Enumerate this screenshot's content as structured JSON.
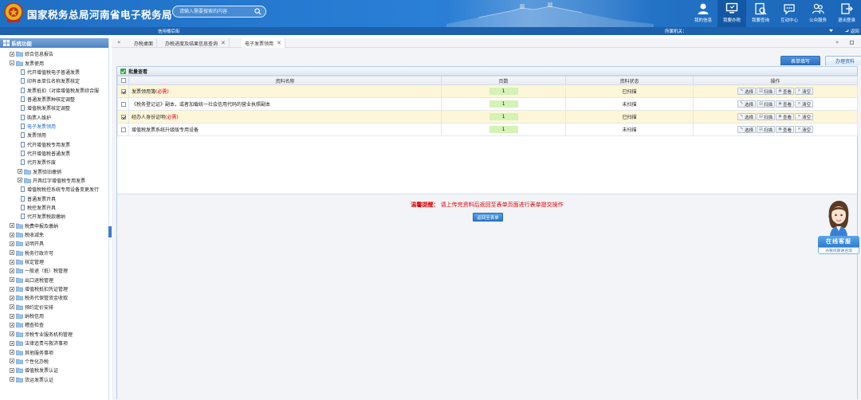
{
  "header": {
    "title": "国家税务总局河南省电子税务局",
    "search_placeholder": "请输入需要搜索的内容",
    "nav": [
      {
        "label": "我的信息",
        "icon": "user-icon"
      },
      {
        "label": "我要办税",
        "icon": "monitor-icon",
        "active": true
      },
      {
        "label": "我要查询",
        "icon": "query-icon"
      },
      {
        "label": "互动中心",
        "icon": "chat-icon"
      },
      {
        "label": "公众服务",
        "icon": "people-icon"
      },
      {
        "label": "退出登录",
        "icon": "exit-icon"
      }
    ]
  },
  "subbar": {
    "address": "信用楼后街",
    "authority": "所属机关：",
    "return_label": "返回"
  },
  "sidebar": {
    "title": "系统功能",
    "items": [
      {
        "label": "综合信息报告",
        "level": 0,
        "type": "folder",
        "expand": "plus"
      },
      {
        "label": "发票使用",
        "level": 0,
        "type": "folder",
        "expand": "minus"
      },
      {
        "label": "代开增值税电子普通发票",
        "level": 1,
        "type": "doc"
      },
      {
        "label": "印有本单位名称发票核定",
        "level": 1,
        "type": "doc"
      },
      {
        "label": "发票抵扣（对接增值税发票综合服",
        "level": 1,
        "type": "doc"
      },
      {
        "label": "普通发票票种核定调整",
        "level": 1,
        "type": "doc"
      },
      {
        "label": "增值税发票核定调整",
        "level": 1,
        "type": "doc"
      },
      {
        "label": "购票人维护",
        "level": 1,
        "type": "doc"
      },
      {
        "label": "电子发票领用",
        "level": 1,
        "type": "doc",
        "selected": true
      },
      {
        "label": "发票领用",
        "level": 1,
        "type": "doc"
      },
      {
        "label": "代开增值税专用发票",
        "level": 1,
        "type": "doc"
      },
      {
        "label": "代开增值税普通发票",
        "level": 1,
        "type": "doc"
      },
      {
        "label": "代开发票作废",
        "level": 1,
        "type": "doc"
      },
      {
        "label": "发票验旧缴销",
        "level": 1,
        "type": "folder",
        "expand": "plus"
      },
      {
        "label": "开具红字增值税专用发票",
        "level": 1,
        "type": "folder",
        "expand": "plus"
      },
      {
        "label": "增值税税控系统专用设备变更发行",
        "level": 1,
        "type": "doc"
      },
      {
        "label": "普通发票开具",
        "level": 1,
        "type": "doc"
      },
      {
        "label": "税控发票开具",
        "level": 1,
        "type": "doc"
      },
      {
        "label": "代开发票税款缴纳",
        "level": 1,
        "type": "doc"
      },
      {
        "label": "税费申报及缴纳",
        "level": 0,
        "type": "folder",
        "expand": "plus"
      },
      {
        "label": "税收减免",
        "level": 0,
        "type": "folder",
        "expand": "plus"
      },
      {
        "label": "证明开具",
        "level": 0,
        "type": "folder",
        "expand": "plus"
      },
      {
        "label": "税务行政许可",
        "level": 0,
        "type": "folder",
        "expand": "plus"
      },
      {
        "label": "核定管理",
        "level": 0,
        "type": "folder",
        "expand": "plus"
      },
      {
        "label": "一般退（抵）税管理",
        "level": 0,
        "type": "folder",
        "expand": "plus"
      },
      {
        "label": "出口退税管理",
        "level": 0,
        "type": "folder",
        "expand": "plus"
      },
      {
        "label": "增值税抵扣凭证管理",
        "level": 0,
        "type": "folder",
        "expand": "plus"
      },
      {
        "label": "税务代保管资金收取",
        "level": 0,
        "type": "folder",
        "expand": "plus"
      },
      {
        "label": "预约定价安排",
        "level": 0,
        "type": "folder",
        "expand": "plus"
      },
      {
        "label": "纳税信用",
        "level": 0,
        "type": "folder",
        "expand": "plus"
      },
      {
        "label": "稽查检查",
        "level": 0,
        "type": "folder",
        "expand": "plus"
      },
      {
        "label": "涉税专业服务机构管理",
        "level": 0,
        "type": "folder",
        "expand": "plus"
      },
      {
        "label": "法律追责与救济事项",
        "level": 0,
        "type": "folder",
        "expand": "plus"
      },
      {
        "label": "其他服务事项",
        "level": 0,
        "type": "folder",
        "expand": "plus"
      },
      {
        "label": "个性化办税",
        "level": 0,
        "type": "folder",
        "expand": "plus"
      },
      {
        "label": "增值税发票认证",
        "level": 0,
        "type": "folder",
        "expand": "plus"
      },
      {
        "label": "货运发票认证",
        "level": 0,
        "type": "folder",
        "expand": "plus"
      }
    ]
  },
  "tabs": {
    "items": [
      {
        "label": "办税桌面",
        "closable": false
      },
      {
        "label": "办税进度及结果信息查询",
        "closable": true
      },
      {
        "label": "电子发票领用",
        "closable": true,
        "active": true
      }
    ]
  },
  "subtabs": {
    "form_fill": "表单填写",
    "upload": "办理资料"
  },
  "panel": {
    "title": "批量查看",
    "columns": [
      "资料名称",
      "页数",
      "资料状态",
      "操作"
    ],
    "rows": [
      {
        "name": "发票领用簿",
        "required": "(必需)",
        "pages": "1",
        "status": "已扫描",
        "status_type": "ok",
        "checked": true,
        "highlight": true
      },
      {
        "name": "《税务登记证》副本，或者加载统一社会信用代码的营业执照副本",
        "required": "",
        "pages": "1",
        "status": "未扫描",
        "status_type": "no",
        "checked": false,
        "highlight": false
      },
      {
        "name": "经办人身份证明",
        "required": "(必需)",
        "pages": "1",
        "status": "已扫描",
        "status_type": "ok",
        "checked": true,
        "highlight": true
      },
      {
        "name": "增值税发票系统升级版专用设备",
        "required": "",
        "pages": "1",
        "status": "未扫描",
        "status_type": "no",
        "checked": false,
        "highlight": false
      }
    ],
    "ops": [
      "选择",
      "扫描",
      "查看",
      "清空"
    ]
  },
  "tip": {
    "label": "温馨提醒：",
    "text": "请上传完资料后返回至表单页面进行表单提交操作",
    "back_button": "返回至表单"
  },
  "customer_service": {
    "title": "在线客服",
    "subtitle": "办税问题请咨询"
  },
  "colors": {
    "header_blue": "#2a7fd6",
    "sub_blue": "#1d61ad",
    "required_red": "#d9001b",
    "status_ok": "#2e9a2e",
    "status_no": "#e00000",
    "highlight_row": "#fdf6d8"
  }
}
